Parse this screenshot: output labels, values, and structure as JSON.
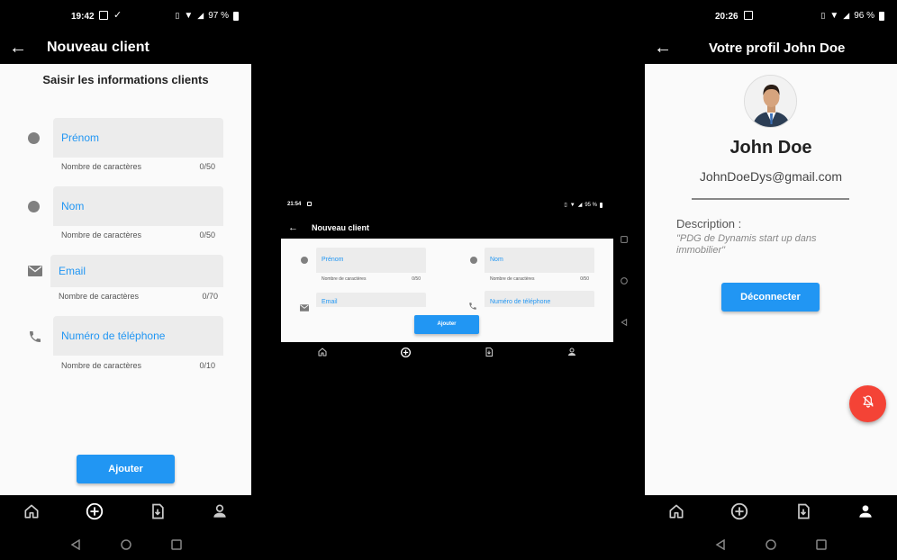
{
  "phone1": {
    "status": {
      "time": "19:42",
      "battery": "97 %"
    },
    "appbar_title": "Nouveau client",
    "heading": "Saisir les informations clients",
    "fields": [
      {
        "label": "Prénom",
        "counter_label": "Nombre de caractères",
        "counter": "0/50",
        "icon": "dot-icon"
      },
      {
        "label": "Nom",
        "counter_label": "Nombre de caractères",
        "counter": "0/50",
        "icon": "dot-icon"
      },
      {
        "label": "Email",
        "counter_label": "Nombre de caractères",
        "counter": "0/70",
        "icon": "mail-icon"
      },
      {
        "label": "Numéro de téléphone",
        "counter_label": "Nombre de caractères",
        "counter": "0/10",
        "icon": "phone-icon"
      }
    ],
    "submit_label": "Ajouter"
  },
  "landscape": {
    "status": {
      "time": "21:54",
      "battery": "95 %"
    },
    "appbar_title": "Nouveau client",
    "fields": [
      {
        "label": "Prénom",
        "counter_label": "Nombre de caractères",
        "counter": "0/50"
      },
      {
        "label": "Nom",
        "counter_label": "Nombre de caractères",
        "counter": "0/50"
      },
      {
        "label": "Email"
      },
      {
        "label": "Numéro de téléphone"
      }
    ],
    "submit_label": "Ajouter"
  },
  "phone3": {
    "status": {
      "time": "20:26",
      "battery": "96 %"
    },
    "appbar_title": "Votre profil John Doe",
    "name": "John Doe",
    "email": "JohnDoeDys@gmail.com",
    "description_label": "Description :",
    "description": "\"PDG de Dynamis start up dans immobilier\"",
    "logout_label": "Déconnecter"
  },
  "nav_icons": [
    "home-icon",
    "add-circle-icon",
    "download-doc-icon",
    "person-icon"
  ],
  "colors": {
    "accent": "#2196f3",
    "fab": "#f44336",
    "background": "#fafafa"
  }
}
